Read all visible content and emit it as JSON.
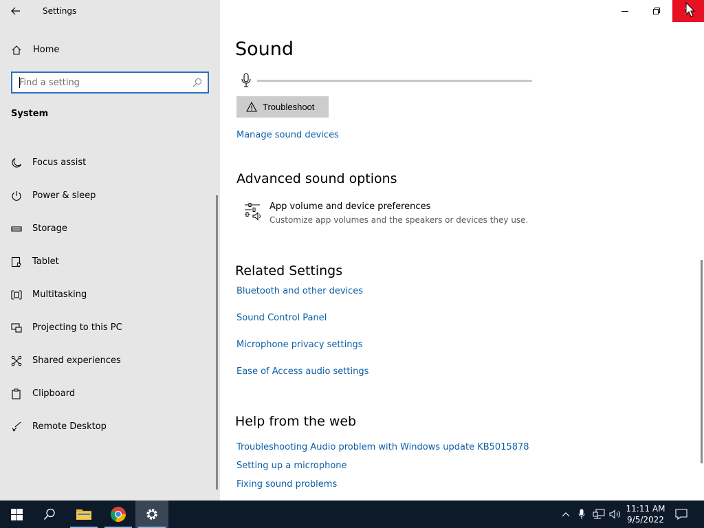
{
  "window": {
    "title": "Settings"
  },
  "sidebar": {
    "home_label": "Home",
    "search_placeholder": "Find a setting",
    "section_title": "System",
    "items": [
      {
        "label": "Focus assist",
        "icon": "moon-icon"
      },
      {
        "label": "Power & sleep",
        "icon": "power-icon"
      },
      {
        "label": "Storage",
        "icon": "storage-icon"
      },
      {
        "label": "Tablet",
        "icon": "tablet-icon"
      },
      {
        "label": "Multitasking",
        "icon": "multitasking-icon"
      },
      {
        "label": "Projecting to this PC",
        "icon": "projecting-icon"
      },
      {
        "label": "Shared experiences",
        "icon": "shared-experiences-icon"
      },
      {
        "label": "Clipboard",
        "icon": "clipboard-icon"
      },
      {
        "label": "Remote Desktop",
        "icon": "remote-desktop-icon"
      }
    ]
  },
  "main": {
    "page_title": "Sound",
    "troubleshoot_label": "Troubleshoot",
    "manage_devices_link": "Manage sound devices",
    "advanced": {
      "heading": "Advanced sound options",
      "item_title": "App volume and device preferences",
      "item_desc": "Customize app volumes and the speakers or devices they use."
    },
    "related": {
      "heading": "Related Settings",
      "links": [
        "Bluetooth and other devices",
        "Sound Control Panel",
        "Microphone privacy settings",
        "Ease of Access audio settings"
      ]
    },
    "help": {
      "heading": "Help from the web",
      "links": [
        "Troubleshooting Audio problem with Windows update KB5015878",
        "Setting up a microphone",
        "Fixing sound problems"
      ]
    }
  },
  "taskbar": {
    "time": "11:11 AM",
    "date": "9/5/2022"
  },
  "colors": {
    "sidebar_bg": "#e6e6e6",
    "accent_link": "#0a5ea8",
    "close_red": "#e81123",
    "taskbar_bg": "#0d1a2a"
  }
}
